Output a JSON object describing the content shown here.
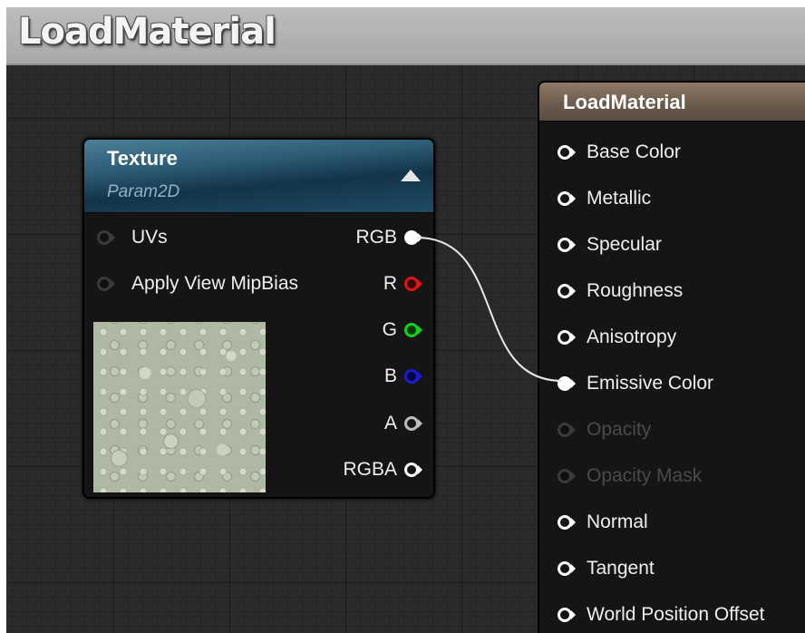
{
  "window": {
    "title": "LoadMaterial"
  },
  "texture_node": {
    "title": "Texture",
    "subtitle": "Param2D",
    "inputs": [
      "UVs",
      "Apply View MipBias"
    ],
    "outputs": [
      "RGB",
      "R",
      "G",
      "B",
      "A",
      "RGBA"
    ]
  },
  "material_node": {
    "title": "LoadMaterial",
    "inputs": [
      "Base Color",
      "Metallic",
      "Specular",
      "Roughness",
      "Anisotropy",
      "Emissive Color",
      "Opacity",
      "Opacity Mask",
      "Normal",
      "Tangent",
      "World Position Offset"
    ],
    "disabled_inputs": [
      "Opacity",
      "Opacity Mask"
    ]
  },
  "connections": [
    {
      "from": "Texture.RGB",
      "to": "LoadMaterial.Emissive Color"
    }
  ],
  "colors": {
    "pin_r": "#e01414",
    "pin_g": "#18d018",
    "pin_b": "#1a1adc",
    "texture_header": "#2b5a73",
    "material_header": "#7a6656"
  }
}
